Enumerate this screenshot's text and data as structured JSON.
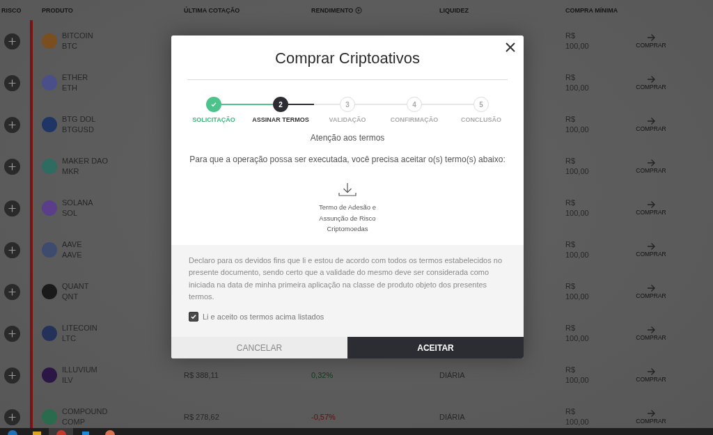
{
  "table": {
    "columns": [
      {
        "label": "RISCO"
      },
      {
        "label": "PRODUTO"
      },
      {
        "label": "ÚLTIMA COTAÇÃO"
      },
      {
        "label": "RENDIMENTO",
        "info_icon": true
      },
      {
        "label": "LIQUIDEZ"
      },
      {
        "label": "COMPRA MÍNIMA"
      }
    ],
    "rows": [
      {
        "name": "BITCOIN",
        "symbol": "BTC",
        "color": "#7a4e1e",
        "min_currency": "R$",
        "min_value": "100,00",
        "action": "COMPRAR"
      },
      {
        "name": "ETHER",
        "symbol": "ETH",
        "color": "#4a4f8a",
        "min_currency": "R$",
        "min_value": "100,00",
        "action": "COMPRAR"
      },
      {
        "name": "BTG DOL",
        "symbol": "BTGUSD",
        "color": "#1f3566",
        "min_currency": "R$",
        "min_value": "100,00",
        "action": "COMPRAR"
      },
      {
        "name": "MAKER DAO",
        "symbol": "MKR",
        "color": "#2e6b60",
        "min_currency": "R$",
        "min_value": "100,00",
        "action": "COMPRAR"
      },
      {
        "name": "SOLANA",
        "symbol": "SOL",
        "color": "#5a3e8a",
        "min_currency": "R$",
        "min_value": "100,00",
        "action": "COMPRAR"
      },
      {
        "name": "AAVE",
        "symbol": "AAVE",
        "color": "#3e4a6e",
        "min_currency": "R$",
        "min_value": "100,00",
        "action": "COMPRAR"
      },
      {
        "name": "QUANT",
        "symbol": "QNT",
        "color": "#1a1a1a",
        "min_currency": "R$",
        "min_value": "100,00",
        "action": "COMPRAR"
      },
      {
        "name": "LITECOIN",
        "symbol": "LTC",
        "color": "#24325a",
        "min_currency": "R$",
        "min_value": "100,00",
        "action": "COMPRAR"
      },
      {
        "name": "ILLUVIUM",
        "symbol": "ILV",
        "color": "#2b1645",
        "price": "R$ 388,11",
        "yield": {
          "text": "0,32%",
          "color": "#0e3a1b"
        },
        "liquidity": "DIÁRIA",
        "min_currency": "R$",
        "min_value": "100,00",
        "action": "COMPRAR"
      },
      {
        "name": "COMPOUND",
        "symbol": "COMP",
        "color": "#2a6b4e",
        "price": "R$ 278,62",
        "yield": {
          "text": "-0,57%",
          "color": "#5a0f0f"
        },
        "liquidity": "DIÁRIA",
        "min_currency": "R$",
        "min_value": "100,00",
        "action": "COMPRAR"
      }
    ]
  },
  "modal": {
    "title": "Comprar Criptoativos",
    "steps": [
      {
        "label": "SOLICITAÇÃO",
        "completed": true,
        "selected": false
      },
      {
        "number": "2",
        "label": "ASSINAR TERMOS",
        "completed": false,
        "selected": true
      },
      {
        "number": "3",
        "label": "VALIDAÇÃO",
        "completed": false,
        "selected": false
      },
      {
        "number": "4",
        "label": "CONFIRMAÇÃO",
        "completed": false,
        "selected": false
      },
      {
        "number": "5",
        "label": "CONCLUSÃO",
        "completed": false,
        "selected": false
      }
    ],
    "subtitle": "Atenção aos termos",
    "instruction": "Para que a operação possa ser executada, você precisa aceitar o(s) termo(s) abaixo:",
    "document": "Termo de Adesão e Assunção de Risco Criptomoedas",
    "declaration": "Declaro para os devidos fins que li e estou de acordo com todos os termos estabelecidos no presente documento, sendo certo que a validade do mesmo deve ser considerada como iniciada na data de minha primeira aplicação na classe de produto objeto dos presentes termos.",
    "agree": {
      "label": "Li e aceito os termos acima listados",
      "checked": true
    },
    "buttons": [
      {
        "label": "CANCELAR",
        "kind": "secondary"
      },
      {
        "label": "ACEITAR",
        "kind": "primary"
      }
    ]
  }
}
